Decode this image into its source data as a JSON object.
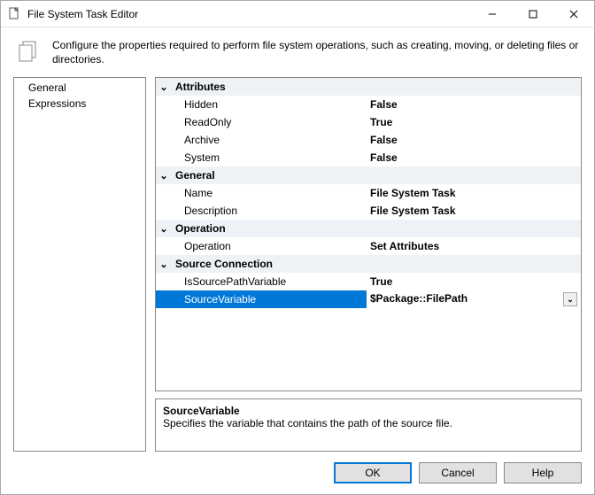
{
  "window": {
    "title": "File System Task Editor"
  },
  "description": "Configure the properties required to perform file system operations, such as creating, moving, or deleting files or directories.",
  "sidebar": {
    "items": [
      {
        "label": "General"
      },
      {
        "label": "Expressions"
      }
    ]
  },
  "propgrid": {
    "categories": [
      {
        "name": "Attributes",
        "rows": [
          {
            "key": "Hidden",
            "value": "False"
          },
          {
            "key": "ReadOnly",
            "value": "True"
          },
          {
            "key": "Archive",
            "value": "False"
          },
          {
            "key": "System",
            "value": "False"
          }
        ]
      },
      {
        "name": "General",
        "rows": [
          {
            "key": "Name",
            "value": "File System Task"
          },
          {
            "key": "Description",
            "value": "File System Task"
          }
        ]
      },
      {
        "name": "Operation",
        "rows": [
          {
            "key": "Operation",
            "value": "Set Attributes"
          }
        ]
      },
      {
        "name": "Source Connection",
        "rows": [
          {
            "key": "IsSourcePathVariable",
            "value": "True"
          },
          {
            "key": "SourceVariable",
            "value": "$Package::FilePath",
            "selected": true,
            "dropdown": true
          }
        ]
      }
    ]
  },
  "help": {
    "title": "SourceVariable",
    "text": "Specifies the variable that contains the path of the source file."
  },
  "buttons": {
    "ok": "OK",
    "cancel": "Cancel",
    "help": "Help"
  }
}
